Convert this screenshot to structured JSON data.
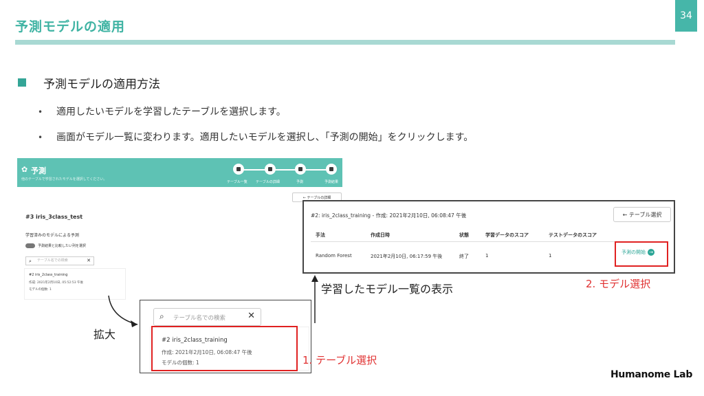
{
  "slide": {
    "title": "予測モデルの適用",
    "page_number": "34",
    "section_title": "予測モデルの適用方法",
    "bullets": [
      "適用したいモデルを学習したテーブルを選択します。",
      "画面がモデル一覧に変わります。適用したいモデルを選択し、「予測の開始」をクリックします。"
    ]
  },
  "screenshot": {
    "header_title": "予測",
    "header_subtitle": "他のテーブルで学習されたモデルを選択してください。",
    "steps": [
      "テーブル一覧",
      "テーブルの詳細",
      "予測",
      "予測結果"
    ],
    "back_button": "← テーブルの詳細",
    "table_heading": "#3 iris_3class_test",
    "section_heading": "学習済みのモデルによる予測",
    "toggle_label": "予測結果と比較したい列を選択",
    "search_placeholder": "テーブル名での検索",
    "card": {
      "title": "#2 iris_2class_training",
      "created": "作成: 2021年2月10日, 05:52:53 午後",
      "model_count": "モデルの個数: 1"
    }
  },
  "model_list": {
    "heading": "#2: iris_2class_training - 作成: 2021年2月10日, 06:08:47 午後",
    "back_button": "← テーブル選択",
    "columns": [
      "手法",
      "作成日時",
      "状態",
      "学習データのスコア",
      "テストデータのスコア"
    ],
    "row": [
      "Random Forest",
      "2021年2月10日, 06:17:59 午後",
      "終了",
      "1",
      "1"
    ],
    "start_button": "予測の開始"
  },
  "zoom": {
    "search_placeholder": "テーブル名での検索",
    "card_title": "#2  iris_2class_training",
    "card_created": "作成: 2021年2月10日, 06:08:47 午後",
    "card_model_count": "モデルの個数: 1"
  },
  "annotations": {
    "zoom_label": "拡大",
    "model_list_label": "学習したモデル一覧の表示",
    "step1": "1. テーブル選択",
    "step2": "2. モデル選択"
  },
  "logo": "Humanome Lab",
  "colors": {
    "accent": "#3fb3a3",
    "header_bar": "#5ec2b4",
    "highlight_red": "#e02020"
  }
}
